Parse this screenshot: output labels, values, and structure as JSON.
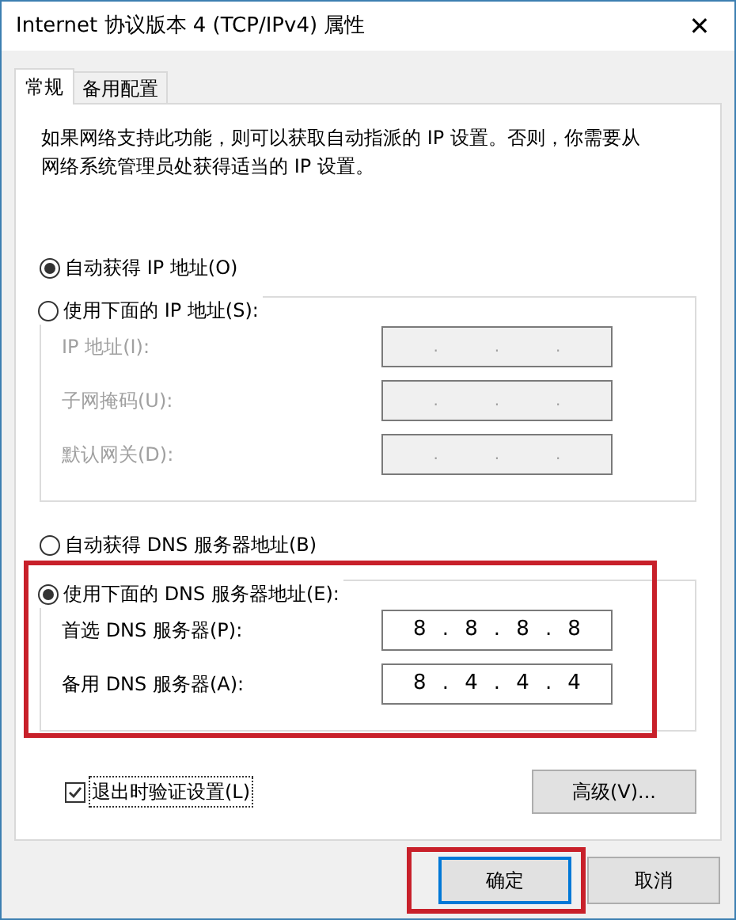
{
  "window": {
    "title": "Internet 协议版本 4 (TCP/IPv4) 属性",
    "close": "✕"
  },
  "tabs": [
    {
      "label": "常规",
      "selected": true
    },
    {
      "label": "备用配置",
      "selected": false
    }
  ],
  "description": "如果网络支持此功能，则可以获取自动指派的 IP 设置。否则，你需要从网络系统管理员处获得适当的 IP 设置。",
  "ip": {
    "auto_radio": {
      "label": "自动获得 IP 地址(O)",
      "selected": true
    },
    "manual_group": {
      "label": "使用下面的 IP 地址(S):",
      "selected": false,
      "highlighted": false,
      "fields": [
        {
          "label": "IP 地址(I):",
          "disabled": true,
          "separator": "."
        },
        {
          "label": "子网掩码(U):",
          "disabled": true,
          "separator": "."
        },
        {
          "label": "默认网关(D):",
          "disabled": true,
          "separator": "."
        }
      ]
    }
  },
  "dns": {
    "auto_radio": {
      "label": "自动获得 DNS 服务器地址(B)",
      "selected": false
    },
    "manual_group": {
      "label": "使用下面的 DNS 服务器地址(E):",
      "selected": true,
      "highlighted": true,
      "fields": [
        {
          "label": "首选 DNS 服务器(P):",
          "disabled": false,
          "separator": ".",
          "octets": [
            "8",
            "8",
            "8",
            "8"
          ]
        },
        {
          "label": "备用 DNS 服务器(A):",
          "disabled": false,
          "separator": ".",
          "octets": [
            "8",
            "4",
            "4",
            "4"
          ]
        }
      ]
    }
  },
  "validate_checkbox": {
    "label": "退出时验证设置(L)",
    "checked": true
  },
  "advanced_button": "高级(V)...",
  "buttons": [
    {
      "label": "确定",
      "default": true,
      "highlighted": true
    },
    {
      "label": "取消",
      "default": false,
      "highlighted": false
    }
  ]
}
